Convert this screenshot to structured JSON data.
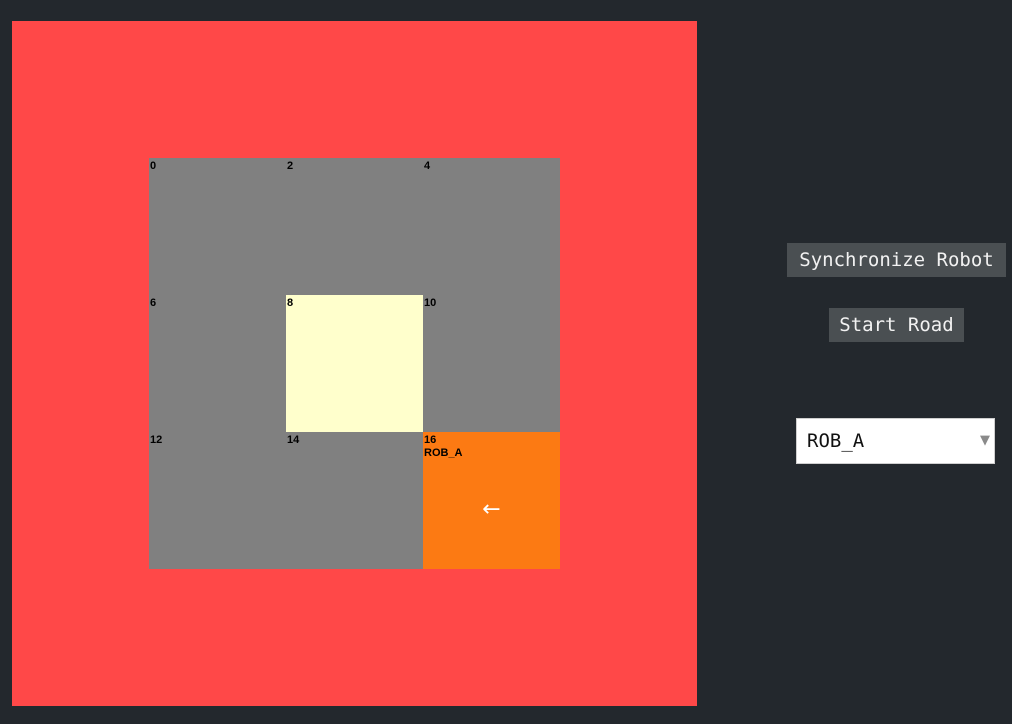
{
  "map": {
    "cells": [
      {
        "id": "0",
        "type": "floor"
      },
      {
        "id": "2",
        "type": "floor"
      },
      {
        "id": "4",
        "type": "floor"
      },
      {
        "id": "6",
        "type": "floor"
      },
      {
        "id": "8",
        "type": "light"
      },
      {
        "id": "10",
        "type": "floor"
      },
      {
        "id": "12",
        "type": "floor"
      },
      {
        "id": "14",
        "type": "floor"
      },
      {
        "id": "16",
        "type": "robot",
        "robot": "ROB_A",
        "heading": "←"
      }
    ],
    "colors": {
      "border": "#ff4848",
      "floor": "#808080",
      "light": "#ffffcc",
      "robot": "#fc7a13",
      "background": "#23282d"
    }
  },
  "controls": {
    "sync_label": "Synchronize Robot",
    "start_label": "Start Road",
    "robot_select_value": "ROB_A",
    "caret_icon": "▼"
  }
}
